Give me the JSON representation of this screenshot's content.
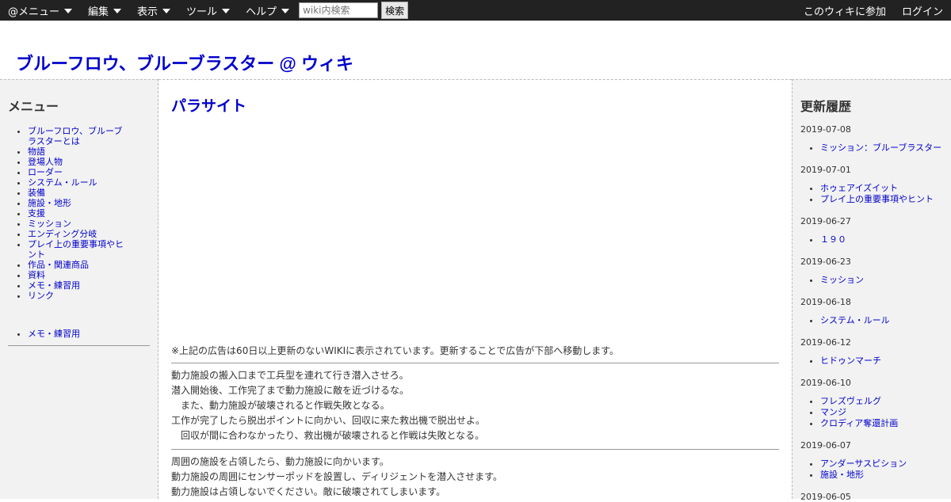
{
  "topbar": {
    "menus": [
      "@メニュー",
      "編集",
      "表示",
      "ツール",
      "ヘルプ"
    ],
    "search_placeholder": "wiki内検索",
    "search_button": "検索",
    "join_label": "このウィキに参加",
    "login_label": "ログイン"
  },
  "site": {
    "title": "ブルーフロウ、ブルーブラスター @ ウィキ"
  },
  "left_menu": {
    "title": "メニュー",
    "items": [
      "ブルーフロウ、ブルーブラスターとは",
      "物語",
      "登場人物",
      "ローダー",
      "システム・ルール",
      "装備",
      "施設・地形",
      "支援",
      "ミッション",
      "エンディング分岐",
      "プレイ上の重要事項やヒント",
      "作品・関連商品",
      "資料",
      "メモ・練習用",
      "リンク"
    ],
    "extra_items": [
      "メモ・練習用"
    ]
  },
  "main": {
    "page_title": "パラサイト",
    "ad_note": "※上記の広告は60日以上更新のないWIKIに表示されています。更新することで広告が下部へ移動します。",
    "block1": [
      "動力施設の搬入口まで工兵型を連れて行き潜入させろ。",
      "潜入開始後、工作完了まで動力施設に敵を近づけるな。",
      "　また、動力施設が破壊されると作戦失敗となる。",
      "工作が完了したら脱出ポイントに向かい、回収に来た救出機で脱出せよ。",
      "　回収が間に合わなかったり、救出機が破壊されると作戦は失敗となる。"
    ],
    "block2": [
      "周囲の施設を占領したら、動力施設に向かいます。",
      "動力施設の周囲にセンサーポッドを設置し、ディリジェントを潜入させます。",
      "動力施設は占領しないでください。敵に破壊されてしまいます。"
    ]
  },
  "recent": {
    "title": "更新履歴",
    "entries": [
      {
        "date": "2019-07-08",
        "items": [
          "ミッション：ブルーブラスター"
        ]
      },
      {
        "date": "2019-07-01",
        "items": [
          "ホゥェアイズイット",
          "プレイ上の重要事項やヒント"
        ]
      },
      {
        "date": "2019-06-27",
        "items": [
          "１９０"
        ]
      },
      {
        "date": "2019-06-23",
        "items": [
          "ミッション"
        ]
      },
      {
        "date": "2019-06-18",
        "items": [
          "システム・ルール"
        ]
      },
      {
        "date": "2019-06-12",
        "items": [
          "ヒドゥンマーチ"
        ]
      },
      {
        "date": "2019-06-10",
        "items": [
          "フレズヴェルグ",
          "マンジ",
          "クロディア奪還計画"
        ]
      },
      {
        "date": "2019-06-07",
        "items": [
          "アンダーサスピション",
          "施設・地形"
        ]
      },
      {
        "date": "2019-06-05",
        "items": []
      }
    ]
  }
}
